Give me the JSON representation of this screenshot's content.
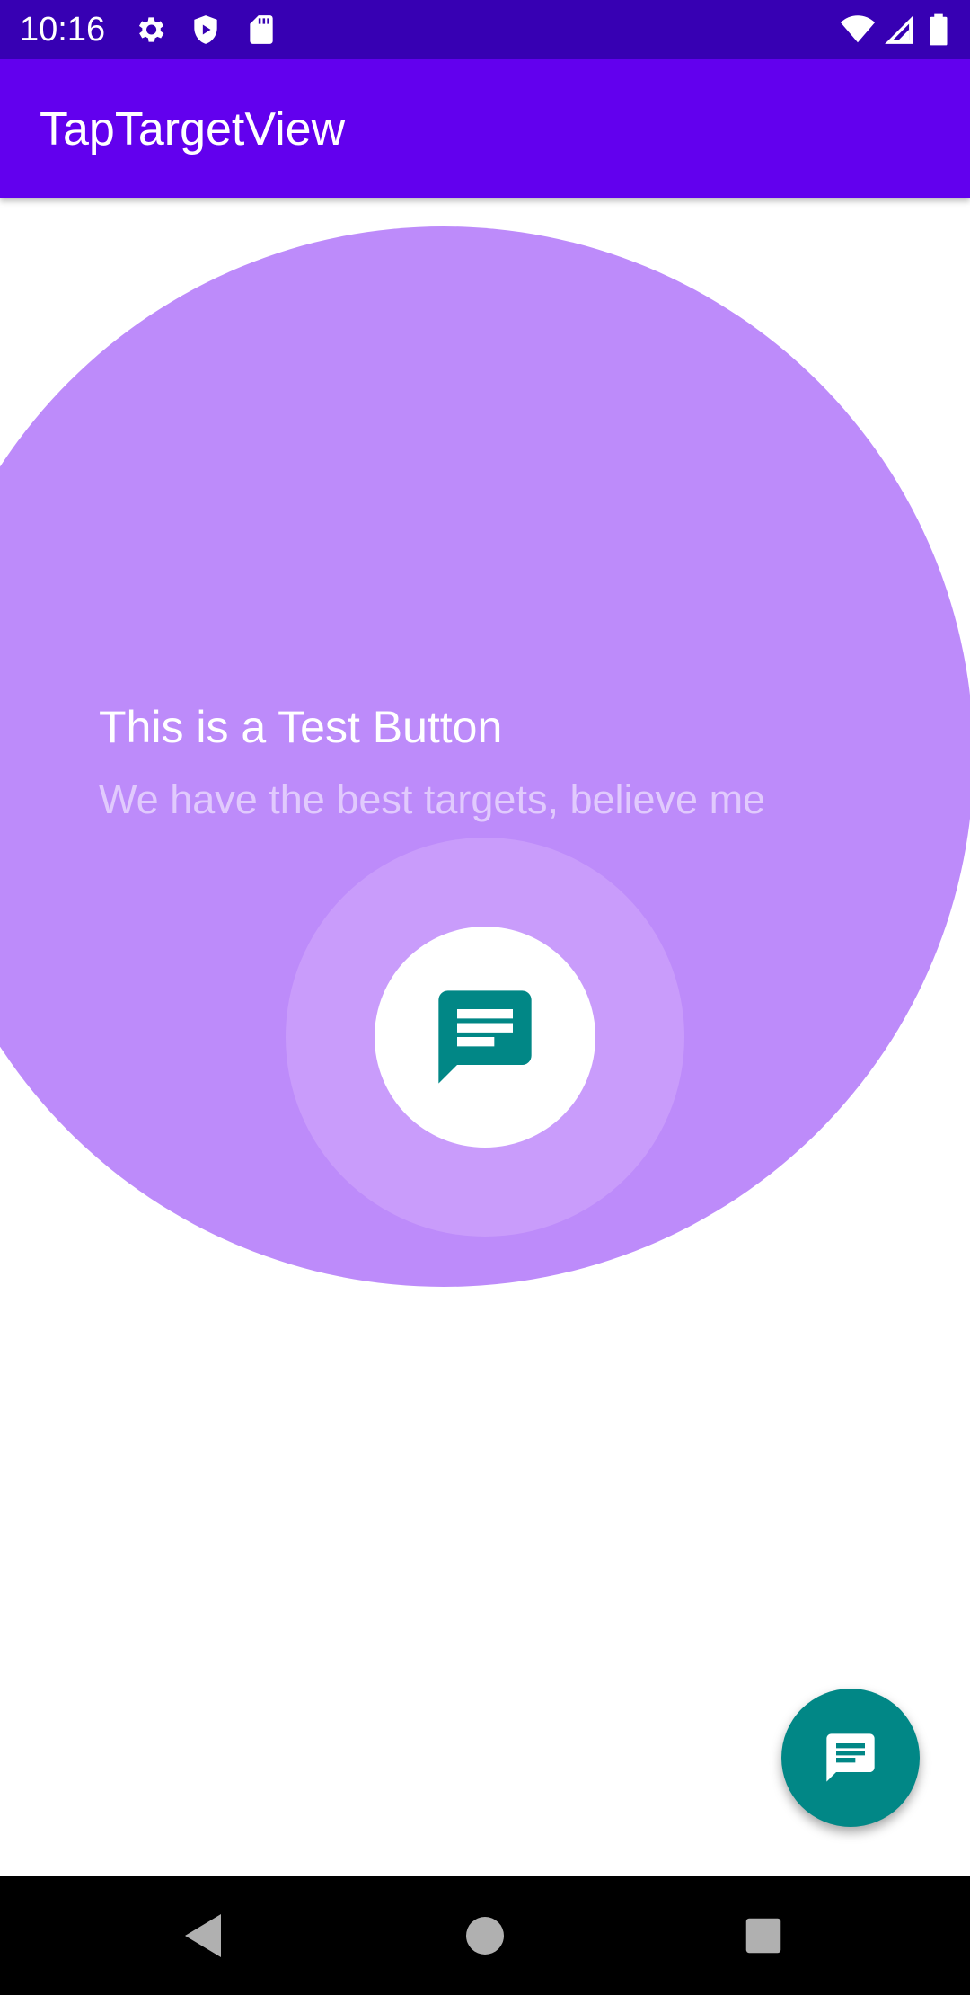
{
  "status_bar": {
    "time": "10:16",
    "background": "#3700b3",
    "left_icons": [
      "settings-gear-icon",
      "play-protect-shield-icon",
      "sd-card-icon"
    ],
    "right_icons": [
      "wifi-icon",
      "cell-signal-icon",
      "battery-icon"
    ]
  },
  "app_bar": {
    "title": "TapTargetView",
    "background": "#6200ee"
  },
  "tap_target": {
    "title": "This is a Test Button",
    "description": "We have the best targets, believe me",
    "outer_circle_color": "#bd8bfa",
    "target_icon": "message-icon",
    "icon_color": "#018786"
  },
  "fab": {
    "icon": "message-icon",
    "background": "#018786"
  },
  "nav_bar": {
    "buttons": [
      "back-icon",
      "home-icon",
      "recents-icon"
    ]
  }
}
